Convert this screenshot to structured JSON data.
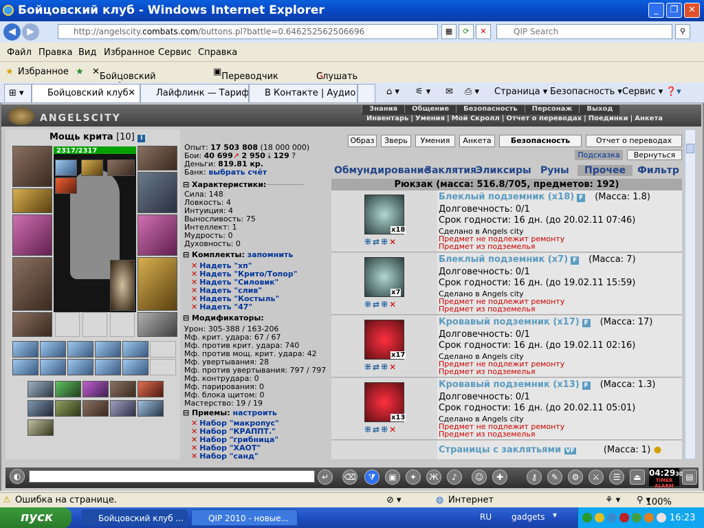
{
  "window": {
    "title": "Бойцовский клуб - Windows Internet Explorer",
    "min": "_",
    "max": "❐",
    "close": "✕"
  },
  "address": {
    "url_pre": "http://angelscity.",
    "url_domain": "combats.com",
    "url_post": "/buttons.pl?battle=0.646252562506696",
    "search_placeholder": "QIP Search"
  },
  "menu": [
    "Файл",
    "Правка",
    "Вид",
    "Избранное",
    "Сервис",
    "Справка"
  ],
  "favorites": {
    "label": "Избранное",
    "links": [
      "Бойцовский клуб. Фор...",
      "Переводчик Google#",
      "Слушать радио Ди-ФМ..."
    ]
  },
  "tabs": [
    "Бойцовский клуб",
    "Лайфлинк — Тарифы",
    "В Контакте | Аудио"
  ],
  "commands": [
    "Страница",
    "Безопасность",
    "Сервис"
  ],
  "game": {
    "logo": "ANGELSCITY",
    "top_links_1": [
      "Знания",
      "Общение",
      "Безопасность",
      "Персонаж",
      "Выход"
    ],
    "top_links_2": [
      "Инвентарь",
      "Умения",
      "Мой Скролл",
      "Отчет о переводах",
      "Поединки",
      "Анкета"
    ],
    "character": {
      "name": "Мощь крита",
      "level": "[10]",
      "hp": "2317/2317"
    },
    "stats": {
      "exp_label": "Опыт:",
      "exp_value": "17 503 808",
      "exp_next": "(18 000 000)",
      "battles_label": "Бои:",
      "battles_wins": "40 699",
      "battles_losses": "2 950",
      "battles_draws": "129",
      "money_label": "Деньги:",
      "money_value": "819.81 кр.",
      "bank_label": "Банк:",
      "bank_link": "выбрать счёт"
    },
    "characteristics": {
      "title": "Характеристики:",
      "items": [
        "Сила: 148",
        "Ловкость: 4",
        "Интуиция: 4",
        "Выносливость: 75",
        "Интеллект: 1",
        "Мудрость: 0",
        "Духовность: 0"
      ]
    },
    "kits": {
      "title": "Комплекты:",
      "remember": "запомнить",
      "items": [
        "Надеть \"хп\"",
        "Надеть \"Крито/Топор\"",
        "Надеть \"Силовик\"",
        "Надеть \"слив\"",
        "Надеть \"Костыль\"",
        "Надеть \"47\""
      ]
    },
    "modifiers": {
      "title": "Модификаторы:",
      "items": [
        "Урон: 305-388 / 163-206",
        "Мф. крит. удара: 67 / 67",
        "Мф. против крит. удара: 740",
        "Мф. против мощ. крит. удара: 42",
        "Мф. увертывания: 28",
        "Мф. против увертывания: 797 / 797",
        "Мф. контрудара: 0",
        "Мф. парирования: 0",
        "Мф. блока щитом: 0",
        "Мастерство: 19 / 19"
      ]
    },
    "techniques": {
      "title": "Приемы:",
      "setup": "настроить",
      "items": [
        "Набор \"макропус\"",
        "Набор \"КРАППТ.\"",
        "Набор \"грибница\"",
        "Набор \"ХАОТ\"",
        "Набор \"санд\""
      ]
    },
    "top_buttons": [
      "Образ",
      "Зверь",
      "Умения",
      "Анкета",
      "Безопасность",
      "Отчет о переводах"
    ],
    "hint": "Подсказка",
    "back": "Вернуться",
    "inv_tabs": [
      "Обмундирование",
      "Заклятия",
      "Эликсиры",
      "Руны",
      "Прочее",
      "Фильтр"
    ],
    "backpack": "Рюкзак (масса: 516.8/705, предметов: 192)",
    "items": [
      {
        "name": "Блеклый подземник (x18)",
        "mass": "(Масса: 1.8)",
        "count": "x18",
        "durability": "Долговечность: 0/1",
        "expiry": "Срок годности: 16 дн. (до 20.02.11 07:46)",
        "made": "Сделано в Angels city",
        "r1": "Предмет не подлежит ремонту",
        "r2": "Предмет из подземелья",
        "color": "green"
      },
      {
        "name": "Блеклый подземник (x7)",
        "mass": "(Масса: 7)",
        "count": "x7",
        "durability": "Долговечность: 0/1",
        "expiry": "Срок годности: 16 дн. (до 19.02.11 15:59)",
        "made": "Сделано в Angels city",
        "r1": "Предмет не подлежит ремонту",
        "r2": "Предмет из подземелья",
        "color": "green"
      },
      {
        "name": "Кровавый подземник (x17)",
        "mass": "(Масса: 17)",
        "count": "x17",
        "durability": "Долговечность: 0/1",
        "expiry": "Срок годности: 16 дн. (до 19.02.11 02:16)",
        "made": "Сделано в Angels city",
        "r1": "Предмет не подлежит ремонту",
        "r2": "Предмет из подземелья",
        "color": "red"
      },
      {
        "name": "Кровавый подземник (x13)",
        "mass": "(Масса: 1.3)",
        "count": "x13",
        "durability": "Долговечность: 0/1",
        "expiry": "Срок годности: 16 дн. (до 20.02.11 05:01)",
        "made": "Сделано в Angels city",
        "r1": "Предмет не подлежит ремонту",
        "r2": "Предмет из подземелья",
        "color": "red"
      }
    ],
    "last_item": {
      "name": "Страницы с заклятьями",
      "badge": "VF",
      "mass": "(Масса: 1)"
    },
    "clock": "04:29",
    "clock_sec": "30",
    "timer": "TIMER",
    "alarm": "ALARM"
  },
  "status": {
    "error": "Ошибка на странице.",
    "zone": "Интернет",
    "zoom": "100%"
  },
  "taskbar": {
    "start": "пуск",
    "tasks": [
      "Бойцовский клуб ...",
      "QIP 2010 - новые..."
    ],
    "lang": "RU",
    "gadgets": "gadgets",
    "time": "16:23"
  }
}
